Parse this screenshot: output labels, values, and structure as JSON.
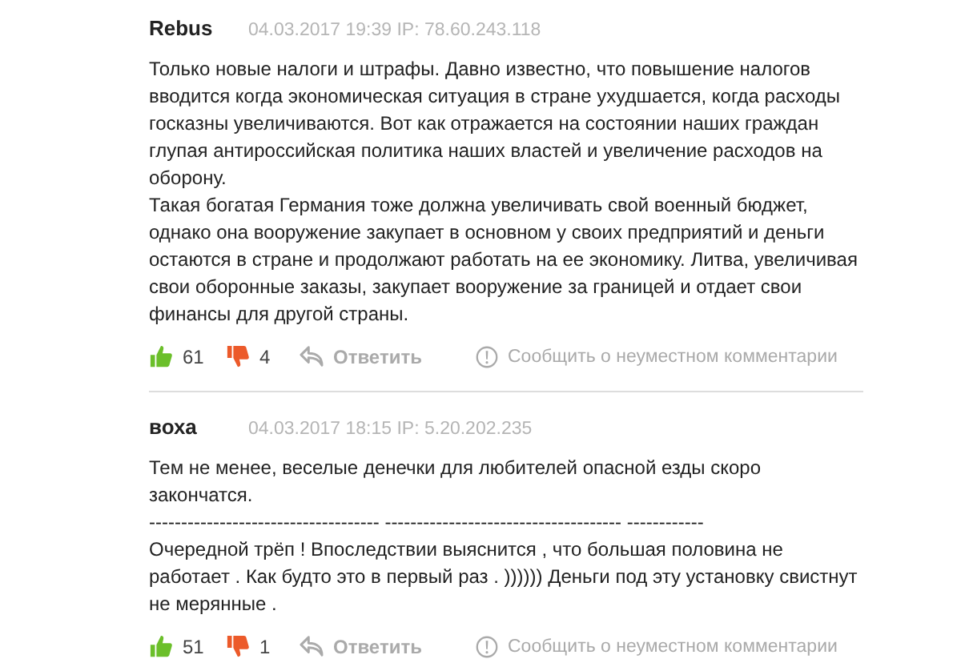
{
  "comments": [
    {
      "author": "Rebus",
      "meta": "04.03.2017 19:39 IP: 78.60.243.118",
      "paragraphs": [
        "Только новые налоги и штрафы. Давно известно, что повышение налогов вводится когда экономическая ситуация в стране ухудшается, когда расходы госказны увеличиваются. Вот как отражается на состоянии наших граждан глупая антироссийская политика наших властей и увеличение расходов на оборону.",
        "Такая богатая Германия тоже должна увеличивать свой военный бюджет, однако она вооружение закупает в основном у своих предприятий и деньги остаются в стране и продолжают работать на ее экономику. Литва, увеличивая свои оборонные заказы, закупает вооружение за границей и отдает свои финансы для другой страны."
      ],
      "likes": "61",
      "dislikes": "4",
      "reply": "Ответить",
      "report": "Сообщить о неуместном комментарии"
    },
    {
      "author": "воха",
      "meta": "04.03.2017 18:15 IP: 5.20.202.235",
      "paragraphs": [
        "Тем не менее, веселые денечки для любителей опасной езды скоро закончатся.",
        "------------------------------------ ------------------------------------- ------------",
        "Очередной трёп ! Впоследствии выяснится , что большая половина не работает . Как будто это в первый раз . )))))) Деньги под эту установку свистнут не мерянные ."
      ],
      "likes": "51",
      "dislikes": "1",
      "reply": "Ответить",
      "report": "Сообщить о неуместном комментарии"
    }
  ]
}
